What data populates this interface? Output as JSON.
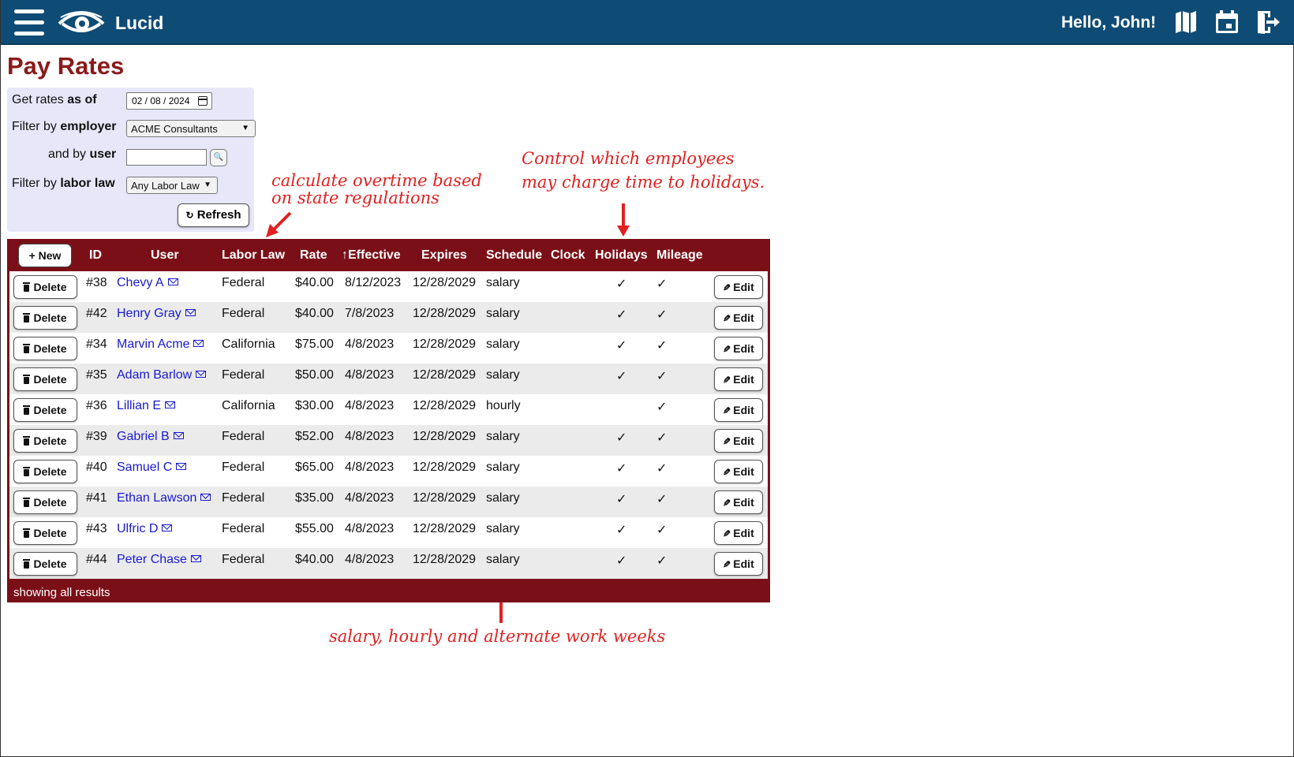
{
  "app": {
    "title": "Lucid",
    "greeting": "Hello, John!"
  },
  "icons": {
    "menu": "hamburger-icon",
    "logo": "eye-logo-icon",
    "map": "map-icon",
    "calendar": "calendar-icon",
    "logout": "logout-icon",
    "search": "search-icon",
    "refresh": "refresh-icon",
    "trash": "trash-icon",
    "pencil": "pencil-icon",
    "mail": "mail-icon",
    "plus": "plus-icon"
  },
  "colors": {
    "header_bg": "#0f4c75",
    "title": "#8b1a1a",
    "table_bg": "#7b0f18",
    "filter_bg": "#e7e7f9",
    "link": "#1a1ad1",
    "annotation": "#e22020"
  },
  "page": {
    "title": "Pay Rates"
  },
  "filters": {
    "rates_as_of": {
      "pre": "Get rates ",
      "bold": "as of",
      "value": "02 / 08 / 2024"
    },
    "employer": {
      "pre": "Filter by ",
      "bold": "employer",
      "value": "ACME Consultants"
    },
    "user": {
      "pre": "and by ",
      "bold": "user",
      "value": ""
    },
    "labor_law": {
      "pre": "Filter by ",
      "bold": "labor law",
      "value": "Any Labor Law"
    },
    "refresh_label": "Refresh"
  },
  "table": {
    "new_label": "New",
    "columns": [
      "ID",
      "User",
      "Labor Law",
      "Rate",
      "↑Effective",
      "Expires",
      "Schedule",
      "Clock",
      "Holidays",
      "Mileage"
    ],
    "delete_label": "Delete",
    "edit_label": "Edit",
    "rows": [
      {
        "id": "#38",
        "user": "Chevy A",
        "law": "Federal",
        "rate": "$40.00",
        "effective": "8/12/2023",
        "expires": "12/28/2029",
        "schedule": "salary",
        "clock": "",
        "holidays": "✓",
        "mileage": "✓"
      },
      {
        "id": "#42",
        "user": "Henry Gray",
        "law": "Federal",
        "rate": "$40.00",
        "effective": "7/8/2023",
        "expires": "12/28/2029",
        "schedule": "salary",
        "clock": "",
        "holidays": "✓",
        "mileage": "✓"
      },
      {
        "id": "#34",
        "user": "Marvin Acme",
        "law": "California",
        "rate": "$75.00",
        "effective": "4/8/2023",
        "expires": "12/28/2029",
        "schedule": "salary",
        "clock": "",
        "holidays": "✓",
        "mileage": "✓"
      },
      {
        "id": "#35",
        "user": "Adam Barlow",
        "law": "Federal",
        "rate": "$50.00",
        "effective": "4/8/2023",
        "expires": "12/28/2029",
        "schedule": "salary",
        "clock": "",
        "holidays": "✓",
        "mileage": "✓"
      },
      {
        "id": "#36",
        "user": "Lillian E",
        "law": "California",
        "rate": "$30.00",
        "effective": "4/8/2023",
        "expires": "12/28/2029",
        "schedule": "hourly",
        "clock": "",
        "holidays": "",
        "mileage": "✓"
      },
      {
        "id": "#39",
        "user": "Gabriel B",
        "law": "Federal",
        "rate": "$52.00",
        "effective": "4/8/2023",
        "expires": "12/28/2029",
        "schedule": "salary",
        "clock": "",
        "holidays": "✓",
        "mileage": "✓"
      },
      {
        "id": "#40",
        "user": "Samuel C",
        "law": "Federal",
        "rate": "$65.00",
        "effective": "4/8/2023",
        "expires": "12/28/2029",
        "schedule": "salary",
        "clock": "",
        "holidays": "✓",
        "mileage": "✓"
      },
      {
        "id": "#41",
        "user": "Ethan Lawson",
        "law": "Federal",
        "rate": "$35.00",
        "effective": "4/8/2023",
        "expires": "12/28/2029",
        "schedule": "salary",
        "clock": "",
        "holidays": "✓",
        "mileage": "✓"
      },
      {
        "id": "#43",
        "user": "Ulfric D",
        "law": "Federal",
        "rate": "$55.00",
        "effective": "4/8/2023",
        "expires": "12/28/2029",
        "schedule": "salary",
        "clock": "",
        "holidays": "✓",
        "mileage": "✓"
      },
      {
        "id": "#44",
        "user": "Peter Chase",
        "law": "Federal",
        "rate": "$40.00",
        "effective": "4/8/2023",
        "expires": "12/28/2029",
        "schedule": "salary",
        "clock": "",
        "holidays": "✓",
        "mileage": "✓"
      }
    ],
    "footer": "showing all results"
  },
  "annotations": {
    "overtime_1": "calculate overtime based",
    "overtime_2": "on state regulations",
    "holidays_1": "Control which employees",
    "holidays_2": "may charge time to holidays.",
    "schedule": "salary, hourly and alternate work weeks"
  }
}
